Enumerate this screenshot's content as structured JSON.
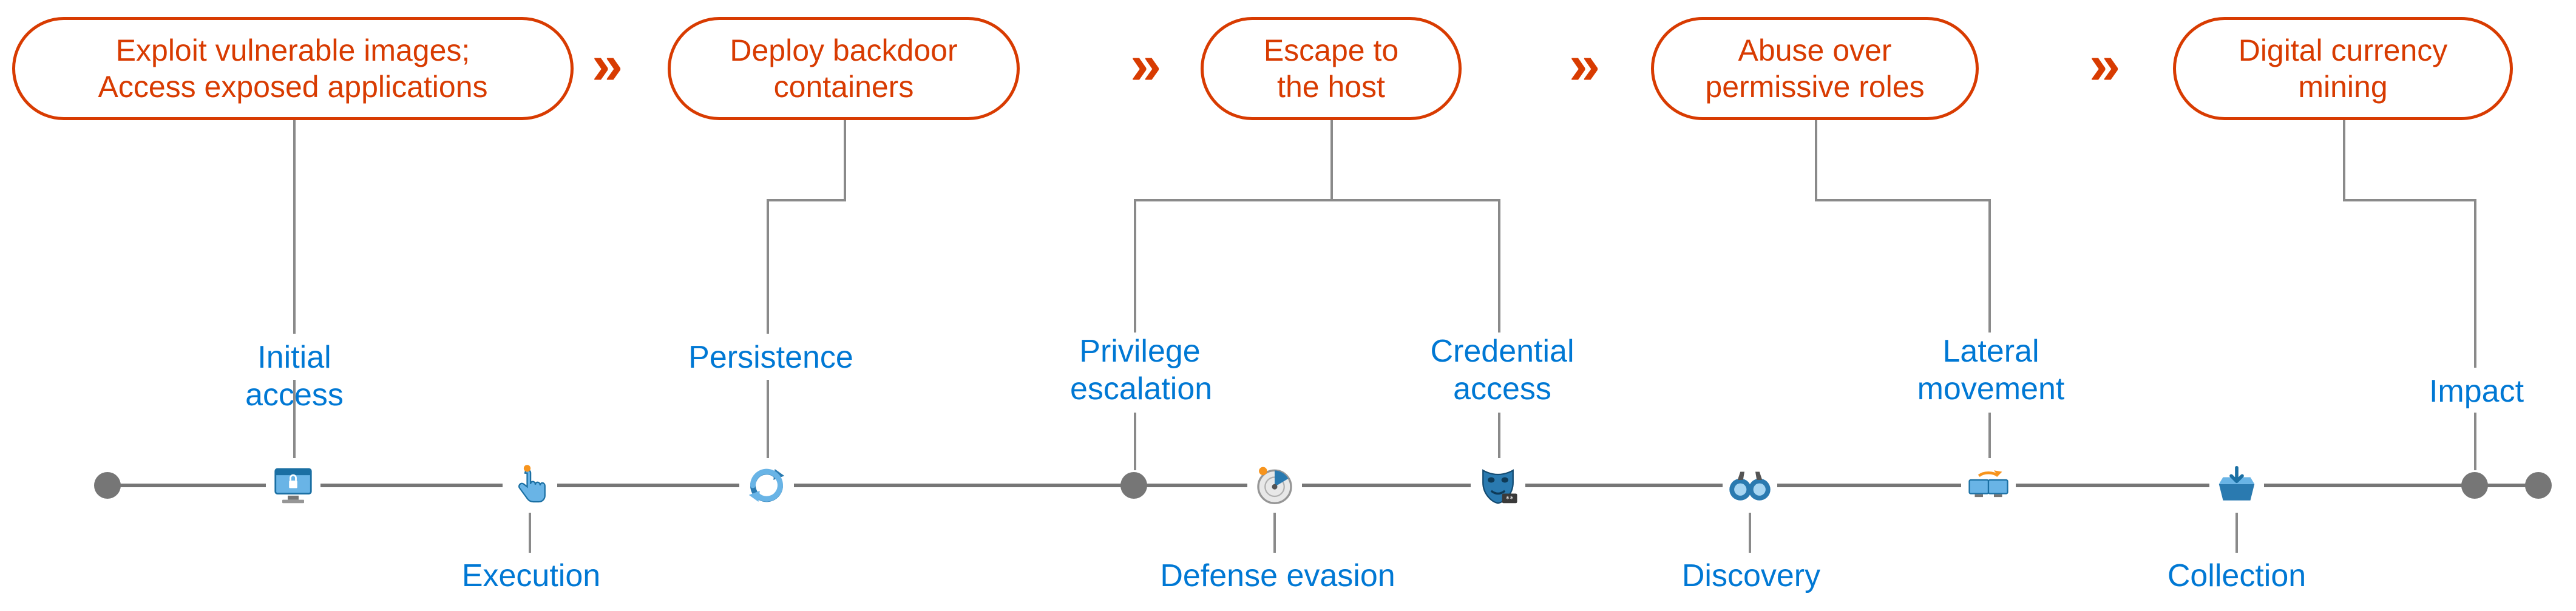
{
  "pills": [
    {
      "id": "p0",
      "html": "Exploit vulnerable images;<br>Access exposed applications"
    },
    {
      "id": "p1",
      "html": "Deploy backdoor<br>containers"
    },
    {
      "id": "p2",
      "html": "Escape to<br>the host"
    },
    {
      "id": "p3",
      "html": "Abuse over<br>permissive roles"
    },
    {
      "id": "p4",
      "html": "Digital currency<br>mining"
    }
  ],
  "tacticsTop": {
    "initial_access": "Initial access",
    "persistence": "Persistence",
    "priv_esc": "Privilege<br>escalation",
    "cred_access": "Credential<br>access",
    "lateral": "Lateral<br>movement",
    "impact": "Impact"
  },
  "tacticsBottom": {
    "execution": "Execution",
    "defense_evasion": "Defense evasion",
    "discovery": "Discovery",
    "collection": "Collection"
  }
}
